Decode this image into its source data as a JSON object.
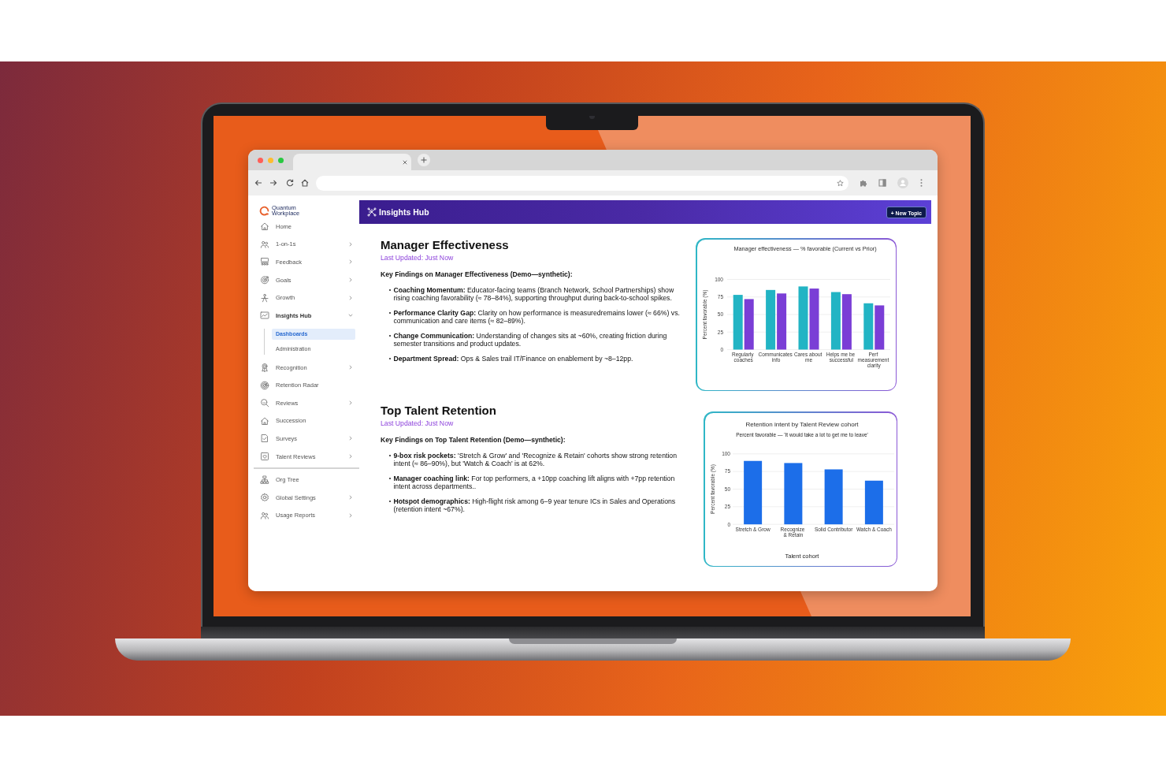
{
  "sidebar": {
    "logo_text": "Quantum Workplace",
    "items": [
      {
        "label": "Home",
        "kind": "link",
        "selected": false,
        "expanded": false
      },
      {
        "label": "1-on-1s",
        "kind": "group",
        "selected": false,
        "expanded": false
      },
      {
        "label": "Feedback",
        "kind": "group",
        "selected": false,
        "expanded": false
      },
      {
        "label": "Goals",
        "kind": "group",
        "selected": false,
        "expanded": false
      },
      {
        "label": "Growth",
        "kind": "group",
        "selected": false,
        "expanded": false
      },
      {
        "label": "Insights Hub",
        "kind": "group",
        "selected": false,
        "expanded": true,
        "children": [
          {
            "label": "Dashboards",
            "selected": true
          },
          {
            "label": "Administration",
            "selected": false
          }
        ]
      },
      {
        "label": "Recognition",
        "kind": "group",
        "selected": false,
        "expanded": false
      },
      {
        "label": "Retention Radar",
        "kind": "link",
        "selected": false,
        "expanded": false
      },
      {
        "label": "Reviews",
        "kind": "group",
        "selected": false,
        "expanded": false
      },
      {
        "label": "Succession",
        "kind": "link",
        "selected": false,
        "expanded": false
      },
      {
        "label": "Surveys",
        "kind": "group",
        "selected": false,
        "expanded": false
      },
      {
        "label": "Talent Reviews",
        "kind": "group",
        "selected": false,
        "expanded": false
      }
    ],
    "footer_items": [
      {
        "label": "Org Tree",
        "kind": "link",
        "selected": false,
        "expanded": false
      },
      {
        "label": "Global Settings",
        "kind": "group",
        "selected": false,
        "expanded": false
      },
      {
        "label": "Usage Reports",
        "kind": "group",
        "selected": false,
        "expanded": false
      }
    ]
  },
  "header": {
    "title": "Insights Hub",
    "button": "+ New Topic"
  },
  "sections": [
    {
      "title": "Manager Effectiveness",
      "updated": "Last Updated: Just Now",
      "intro": "Key Findings on Manager Effectiveness (Demo—synthetic):",
      "bullets": [
        "**Coaching Momentum:** Educator-facing teams (Branch Network, School Partnerships) show rising coaching favorability (≈ 78–84%), supporting throughput during back-to-school spikes.",
        "**Performance Clarity Gap:** Clarity on how performance is measuredremains lower (≈ 66%) vs. communication and care items (≈ 82–89%).",
        "**Change Communication:** Understanding of changes sits at ~60%, creating friction during semester transitions and product updates.",
        "**Department Spread:** Ops & Sales trail IT/Finance on enablement by ~8–12pp."
      ],
      "chart": {
        "chart_data": {
          "type": "bar",
          "title": "Manager effectiveness — % favorable (Current vs Prior)",
          "ylabel": "Percent favorable (%)",
          "categories": [
            "Regularly\ncoaches",
            "Communicates\ninfo",
            "Cares about\nme",
            "Helps me be\nsuccessful",
            "Perf\nmeasurement\nclarity"
          ],
          "series": [
            {
              "color": "#22b4c4",
              "values": [
                78,
                85,
                90,
                82,
                66
              ]
            },
            {
              "color": "#7a3ed6",
              "values": [
                72,
                80,
                87,
                79,
                63
              ]
            }
          ],
          "ylim": [
            0,
            100
          ],
          "yticks": [
            0,
            25,
            50,
            75,
            100
          ],
          "grid": true
        }
      }
    },
    {
      "title": "Top Talent Retention",
      "updated": "Last Updated: Just Now",
      "intro": "Key Findings on Top Talent Retention (Demo—synthetic):",
      "bullets": [
        "**9-box risk pockets:** 'Stretch & Grow' and 'Recognize & Retain' cohorts show strong retention intent (≈ 86–90%), but 'Watch & Coach' is at 62%.",
        "**Manager coaching link:** For top performers, a +10pp coaching lift aligns with +7pp retention intent across departments..",
        "**Hotspot demographics:** High-flight risk among 6–9 year tenure ICs in Sales and Operations (retention intent ~67%)."
      ],
      "chart": {
        "subtitle": "Percent favorable — 'It would take a lot to get me to leave'",
        "chart_data": {
          "type": "bar",
          "title": "Retention intent by Talent Review cohort",
          "xlabel": "Talent cohort",
          "ylabel": "Percent favorable (%)",
          "categories": [
            "Stretch & Grow",
            "Recognize\n& Retain",
            "Solid Contributor",
            "Watch & Coach"
          ],
          "series": [
            {
              "color": "#1c6ee9",
              "values": [
                90,
                87,
                78,
                62
              ]
            }
          ],
          "ylim": [
            0,
            100
          ],
          "yticks": [
            0,
            25,
            50,
            75,
            100
          ],
          "grid": true
        }
      }
    }
  ]
}
